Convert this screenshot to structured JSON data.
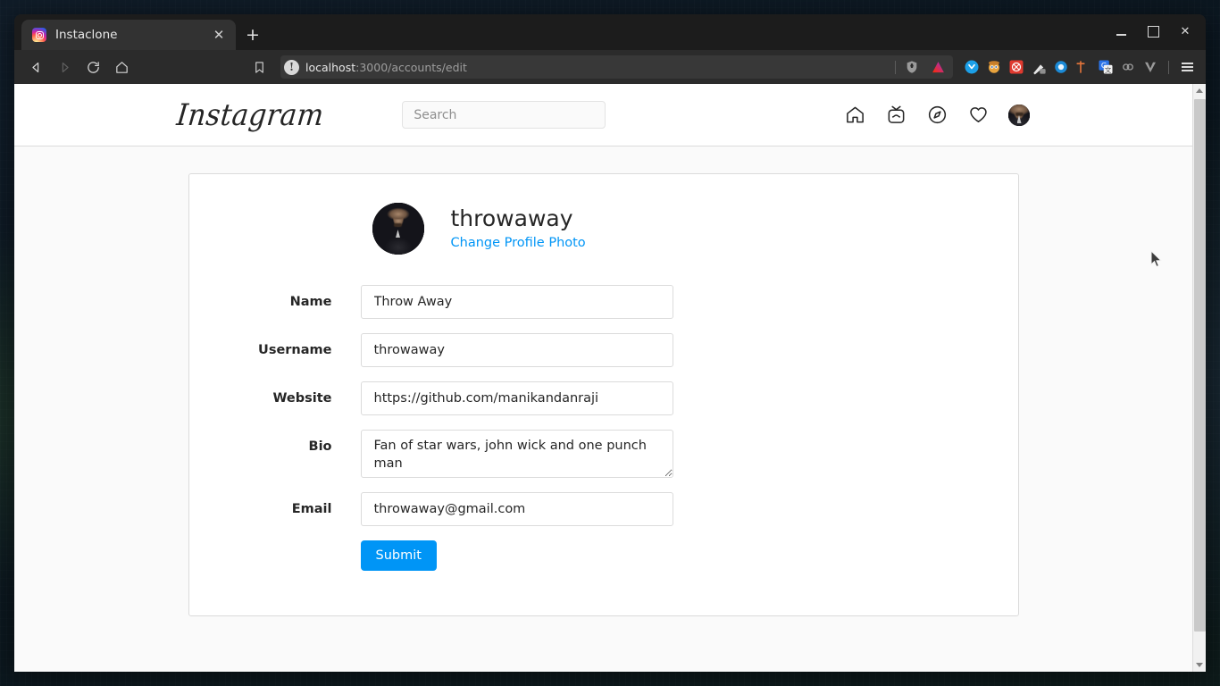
{
  "browser": {
    "tab": {
      "title": "Instaclone",
      "favicon": "instagram-icon",
      "close_label": "✕"
    },
    "new_tab_label": "+",
    "window_controls": {
      "minimize": "—",
      "maximize": "▢",
      "close": "✕"
    },
    "toolbar": {
      "back_icon": "back-arrow-icon",
      "forward_icon": "forward-arrow-icon",
      "reload_icon": "reload-icon",
      "home_icon": "home-icon",
      "bookmark_icon": "bookmark-icon",
      "url_info_icon": "not-secure-icon",
      "url_host": "localhost",
      "url_path": ":3000/accounts/edit",
      "url_full": "localhost:3000/accounts/edit",
      "shield_icon": "brave-shield-icon",
      "rewards_icon": "brave-rewards-icon",
      "extensions": [
        "pocket-icon",
        "grammarly-icon",
        "adblock-icon",
        "colorpick-icon",
        "onepassword-icon",
        "git-icon",
        "google-translate-icon",
        "tampermonkey-icon",
        "vimium-icon"
      ],
      "menu_icon": "hamburger-menu-icon"
    },
    "colors": {
      "chrome_bg": "#2b2b2b",
      "tabstrip_bg": "#1c1c1c",
      "tab_active_bg": "#323232"
    }
  },
  "site": {
    "logo_text": "Instagram",
    "search": {
      "placeholder": "Search",
      "value": ""
    },
    "nav": [
      {
        "name": "home-icon",
        "label": "Home"
      },
      {
        "name": "igtv-icon",
        "label": "IGTV"
      },
      {
        "name": "explore-icon",
        "label": "Explore"
      },
      {
        "name": "heart-icon",
        "label": "Activity"
      },
      {
        "name": "avatar",
        "label": "Profile"
      }
    ]
  },
  "profile": {
    "avatar_alt": "profile-photo",
    "username": "throwaway",
    "change_photo_label": "Change Profile Photo",
    "accent_color": "#0095f6"
  },
  "form": {
    "fields": [
      {
        "label": "Name",
        "value": "Throw Away",
        "type": "text"
      },
      {
        "label": "Username",
        "value": "throwaway",
        "type": "text"
      },
      {
        "label": "Website",
        "value": "https://github.com/manikandanraji",
        "type": "text"
      },
      {
        "label": "Bio",
        "value": "Fan of star wars, john wick and one punch man",
        "type": "textarea"
      },
      {
        "label": "Email",
        "value": "throwaway@gmail.com",
        "type": "text"
      }
    ],
    "submit_label": "Submit"
  },
  "scrollbar": {
    "up_arrow": "scroll-up-icon",
    "down_arrow": "scroll-down-icon"
  }
}
